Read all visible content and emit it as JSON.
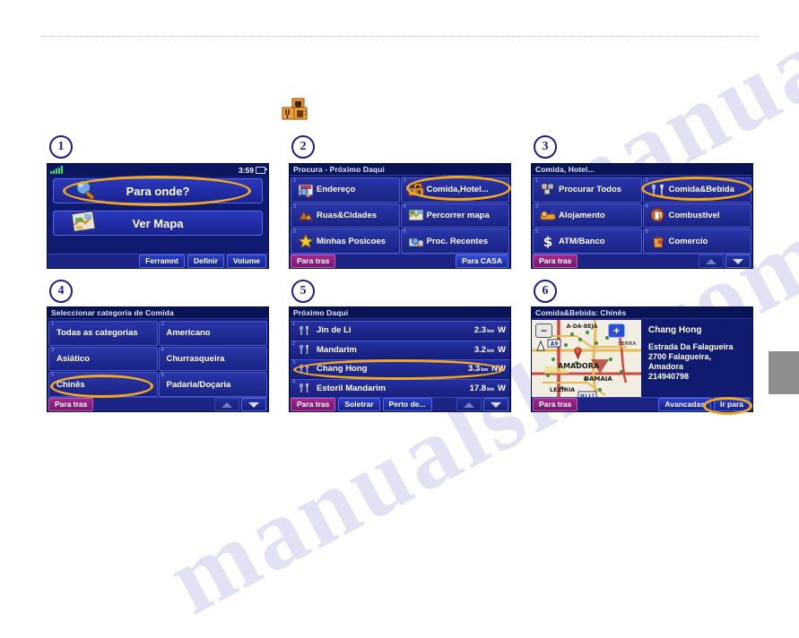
{
  "page": {
    "watermark": "manualslib.com",
    "top_icon": "food-hotel-icon"
  },
  "steps": [
    {
      "number": "1"
    },
    {
      "number": "2"
    },
    {
      "number": "3"
    },
    {
      "number": "4"
    },
    {
      "number": "5"
    },
    {
      "number": "6"
    }
  ],
  "screen1": {
    "status": {
      "time": "3:59",
      "signal_icon": "signal-bars-icon",
      "battery_icon": "battery-icon"
    },
    "buttons": [
      {
        "label": "Para onde?",
        "icon": "magnifier-icon",
        "highlighted": true
      },
      {
        "label": "Ver Mapa",
        "icon": "map-icon",
        "highlighted": false
      }
    ],
    "footer": [
      {
        "label": "Ferramnt"
      },
      {
        "label": "Definir"
      },
      {
        "label": "Volume"
      }
    ]
  },
  "screen2": {
    "title": "Procura - Próximo Daqui",
    "tiles": [
      {
        "num": "1",
        "label": "Endereço",
        "icon": "address-icon",
        "highlighted": false
      },
      {
        "num": "2",
        "label": "Comida,Hotel...",
        "icon": "food-hotel-icon",
        "highlighted": true
      },
      {
        "num": "3",
        "label": "Ruas&Cidades",
        "icon": "streets-cities-icon",
        "highlighted": false
      },
      {
        "num": "4",
        "label": "Percorrer mapa",
        "icon": "browse-map-icon",
        "highlighted": false
      },
      {
        "num": "5",
        "label": "Minhas Posicoes",
        "icon": "star-icon",
        "highlighted": false
      },
      {
        "num": "6",
        "label": "Proc. Recentes",
        "icon": "recent-finds-icon",
        "highlighted": false
      }
    ],
    "footer": {
      "back": "Para tras",
      "home": "Para CASA"
    }
  },
  "screen3": {
    "title": "Comida, Hotel...",
    "tiles": [
      {
        "num": "1",
        "label": "Procurar Todos",
        "icon": "spell-all-icon",
        "highlighted": false
      },
      {
        "num": "2",
        "label": "Comida&Bebida",
        "icon": "food-drink-icon",
        "highlighted": true
      },
      {
        "num": "3",
        "label": "Alojamento",
        "icon": "lodging-icon",
        "highlighted": false
      },
      {
        "num": "4",
        "label": "Combustivel",
        "icon": "fuel-icon",
        "highlighted": false
      },
      {
        "num": "5",
        "label": "ATM/Banco",
        "icon": "bank-dollar-icon",
        "highlighted": false
      },
      {
        "num": "6",
        "label": "Comercio",
        "icon": "shopping-icon",
        "highlighted": false
      }
    ],
    "footer": {
      "back": "Para tras",
      "scroll_up": "scroll-up-icon",
      "scroll_down": "scroll-down-icon"
    }
  },
  "screen4": {
    "title": "Seleccionar categoria de Comida",
    "tiles": [
      {
        "num": "1",
        "label": "Todas as categorias",
        "highlighted": false
      },
      {
        "num": "2",
        "label": "Americano",
        "highlighted": false
      },
      {
        "num": "3",
        "label": "Asiático",
        "highlighted": false
      },
      {
        "num": "4",
        "label": "Churrasqueira",
        "highlighted": false
      },
      {
        "num": "5",
        "label": "Chinês",
        "highlighted": true
      },
      {
        "num": "6",
        "label": "Padaria/Doçaria",
        "highlighted": false
      }
    ],
    "footer": {
      "back": "Para tras",
      "scroll_up": "scroll-up-icon",
      "scroll_down": "scroll-down-icon"
    }
  },
  "screen5": {
    "title": "Próximo Daqui",
    "rows": [
      {
        "num": "1",
        "name": "Jin de Li",
        "distance": "2.3",
        "unit": "km",
        "direction": "W",
        "highlighted": false
      },
      {
        "num": "2",
        "name": "Mandarim",
        "distance": "3.2",
        "unit": "km",
        "direction": "W",
        "highlighted": false
      },
      {
        "num": "3",
        "name": "Chang Hong",
        "distance": "3.3",
        "unit": "km",
        "direction": "NW",
        "highlighted": true
      },
      {
        "num": "4",
        "name": "Estoril Mandarim",
        "distance": "17.8",
        "unit": "km",
        "direction": "W",
        "highlighted": false
      }
    ],
    "footer": [
      {
        "label": "Para tras"
      },
      {
        "label": "Soletrar"
      },
      {
        "label": "Perto de..."
      }
    ]
  },
  "screen6": {
    "title": "Comida&Bebida: Chinês",
    "map": {
      "zoom_out": "−",
      "zoom_in": "+",
      "labels": [
        "A-DA-BEJA",
        "A9",
        "SERRA",
        "AMADORA",
        "DAMAIA",
        "LEZIRIA",
        "N117"
      ],
      "pin_icon": "map-pin-icon"
    },
    "place": "Chang Hong",
    "address_lines": [
      "Estrada Da Falagueira",
      "2700 Falagueira,",
      "Amadora",
      "214940798"
    ],
    "footer": {
      "back": "Para tras",
      "advanced": "Avancadas",
      "go": "Ir para"
    }
  }
}
